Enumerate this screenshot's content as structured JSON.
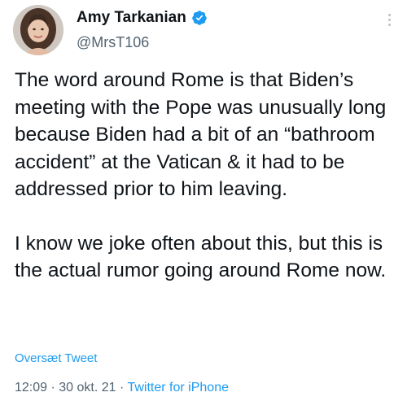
{
  "tweet": {
    "author": {
      "display_name": "Amy Tarkanian",
      "handle": "@MrsT106",
      "verified": true,
      "verified_color": "#1d9bf0"
    },
    "text_paragraphs": [
      "The word around Rome is that Biden’s meeting with the Pope was unusually long because Biden had a bit of an “bathroom accident” at the Vatican & it had to be addressed prior to him leaving.",
      "I know we joke often about this, but this is the actual rumor going around Rome now."
    ],
    "translate_link": "Oversæt Tweet",
    "time": "12:09",
    "separator": " · ",
    "date": "30 okt. 21",
    "source": "Twitter for iPhone",
    "icons": {
      "more": "more-vertical-icon",
      "verified": "verified-badge-icon"
    }
  }
}
